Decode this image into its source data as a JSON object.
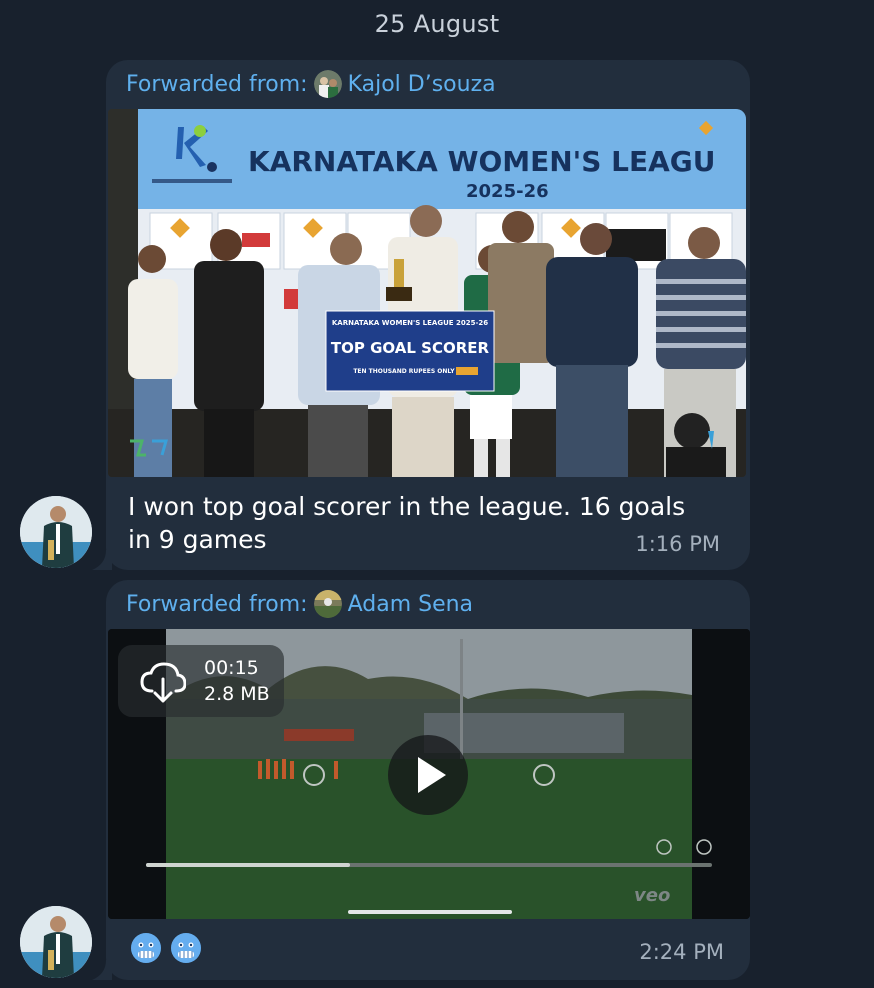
{
  "date_separator": "25 August",
  "messages": [
    {
      "forwarded_label": "Forwarded from:",
      "forwarded_name": "Kajol D’souza",
      "photo": {
        "banner_title": "KARNATAKA WOMEN'S LEAGU",
        "banner_year": "2025-26",
        "board_header": "KARNATAKA WOMEN'S LEAGUE 2025-26",
        "board_title": "TOP GOAL SCORER",
        "board_amount": "TEN THOUSAND RUPEES ONLY"
      },
      "text": "I won top goal scorer in the league. 16 goals in 9 games",
      "time": "1:16 PM"
    },
    {
      "forwarded_label": "Forwarded from:",
      "forwarded_name": "Adam Sena",
      "video": {
        "duration": "00:15",
        "size": "2.8 MB",
        "watermark": "veo"
      },
      "reactions": [
        "cold-face-emoji",
        "cold-face-emoji"
      ],
      "time": "2:24 PM"
    }
  ],
  "colors": {
    "background": "#18212d",
    "bubble": "#222e3d",
    "link": "#5fb0ee",
    "timestamp": "#a4b0bd"
  }
}
